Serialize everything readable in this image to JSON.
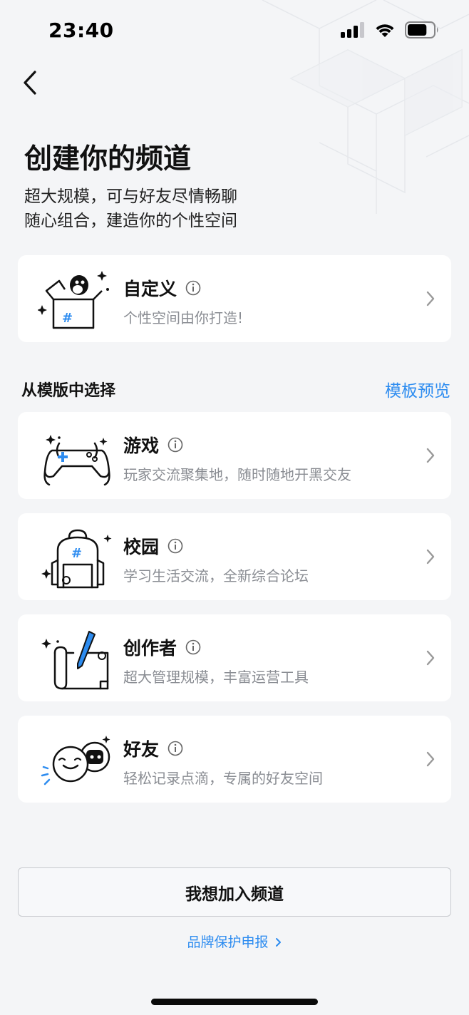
{
  "status_bar": {
    "time": "23:40",
    "battery_level": 0.75
  },
  "header": {
    "title": "创建你的频道",
    "subtitle_line1": "超大规模，可与好友尽情畅聊",
    "subtitle_line2": "随心组合，建造你的个性空间"
  },
  "custom_card": {
    "title": "自定义",
    "desc": "个性空间由你打造!"
  },
  "templates": {
    "section_label": "从模版中选择",
    "preview_link": "模板预览",
    "items": [
      {
        "title": "游戏",
        "desc": "玩家交流聚集地，随时随地开黑交友",
        "icon": "gamepad-icon"
      },
      {
        "title": "校园",
        "desc": "学习生活交流，全新综合论坛",
        "icon": "backpack-icon"
      },
      {
        "title": "创作者",
        "desc": "超大管理规模，丰富运营工具",
        "icon": "scroll-pen-icon"
      },
      {
        "title": "好友",
        "desc": "轻松记录点滴，专属的好友空间",
        "icon": "friends-icon"
      }
    ]
  },
  "footer": {
    "join_button": "我想加入频道",
    "report_link": "品牌保护申报"
  },
  "colors": {
    "accent": "#2d8cf0",
    "background": "#f4f5f7",
    "card": "#ffffff",
    "muted_text": "#8a8d93"
  }
}
